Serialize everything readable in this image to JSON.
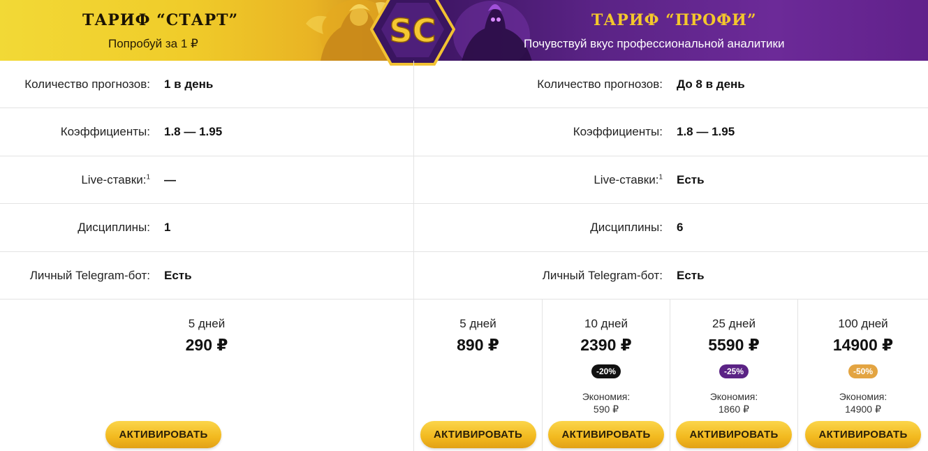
{
  "banner": {
    "start_title": "ТАРИФ “СТАРТ”",
    "start_subtitle": "Попробуй за 1 ₽",
    "profi_title": "ТАРИФ “ПРОФИ”",
    "profi_subtitle": "Почувствуй вкус профессиональной аналитики",
    "logo_text": "SC",
    "colors": {
      "start_bg": "#f0cc2a",
      "profi_bg": "#5a2385",
      "profi_title": "#f4c72c"
    }
  },
  "features": {
    "start": [
      {
        "label": "Количество прогнозов:",
        "value": "1 в день"
      },
      {
        "label": "Коэффициенты:",
        "value": "1.8 — 1.95"
      },
      {
        "label": "Live-ставки:",
        "sup": "1",
        "value": "—"
      },
      {
        "label": "Дисциплины:",
        "value": "1"
      },
      {
        "label": "Личный Telegram-бот:",
        "value": "Есть"
      }
    ],
    "profi": [
      {
        "label": "Количество прогнозов:",
        "value": "До 8 в день"
      },
      {
        "label": "Коэффициенты:",
        "value": "1.8 — 1.95"
      },
      {
        "label": "Live-ставки:",
        "sup": "1",
        "value": "Есть"
      },
      {
        "label": "Дисциплины:",
        "value": "6"
      },
      {
        "label": "Личный Telegram-бот:",
        "value": "Есть"
      }
    ]
  },
  "pricing": {
    "start": [
      {
        "days": "5 дней",
        "price": "290 ₽",
        "button": "АКТИВИРОВАТЬ"
      }
    ],
    "profi": [
      {
        "days": "5 дней",
        "price": "890 ₽",
        "button": "АКТИВИРОВАТЬ"
      },
      {
        "days": "10 дней",
        "price": "2390 ₽",
        "discount": "-20%",
        "savings_label": "Экономия:",
        "savings": "590 ₽",
        "button": "АКТИВИРОВАТЬ"
      },
      {
        "days": "25 дней",
        "price": "5590 ₽",
        "discount": "-25%",
        "savings_label": "Экономия:",
        "savings": "1860 ₽",
        "button": "АКТИВИРОВАТЬ"
      },
      {
        "days": "100 дней",
        "price": "14900 ₽",
        "discount": "-50%",
        "savings_label": "Экономия:",
        "savings": "14900 ₽",
        "button": "АКТИВИРОВАТЬ"
      }
    ],
    "colors": {
      "button": "#f2b91f",
      "badge_20": "#111111",
      "badge_25": "#5b2385",
      "badge_50": "#e3a441"
    }
  }
}
